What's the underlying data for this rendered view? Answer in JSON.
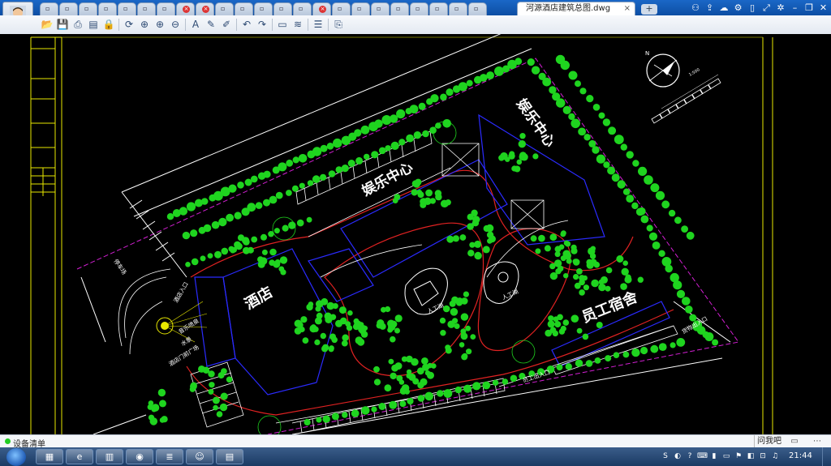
{
  "window": {
    "active_tab_title": "河源酒店建筑总图.dwg",
    "close_glyph": "×",
    "add_tab_glyph": "+",
    "tab_glyphs": [
      "▫",
      "▫",
      "▫",
      "▫",
      "▫",
      "▫",
      "▫",
      "×",
      "×",
      "▫",
      "▫",
      "▫",
      "▫",
      "▫",
      "×",
      "▫",
      "▫",
      "▫",
      "▫",
      "▫",
      "▫",
      "▫",
      "▫"
    ],
    "system_buttons": [
      "user-icon",
      "share-icon",
      "cloud-icon",
      "gear-alt-icon",
      "phone-icon",
      "expand-icon",
      "settings-icon",
      "minimize-icon",
      "maximize-icon",
      "close-icon"
    ],
    "system_glyphs": [
      "⚇",
      "⇪",
      "☁",
      "⚙",
      "▯",
      "⤢",
      "✲",
      "–",
      "❐",
      "✕"
    ]
  },
  "toolbar": {
    "items": [
      {
        "name": "open-icon",
        "glyph": "📂"
      },
      {
        "name": "save-icon",
        "glyph": "💾"
      },
      {
        "name": "print-icon",
        "glyph": "⎙"
      },
      {
        "name": "pdf-icon",
        "glyph": "▤"
      },
      {
        "name": "lock-icon",
        "glyph": "🔒"
      },
      {
        "name": "rotate-icon",
        "glyph": "⟳"
      },
      {
        "name": "zoom-icon",
        "glyph": "⊕"
      },
      {
        "name": "zoom-in-icon",
        "glyph": "⊕"
      },
      {
        "name": "zoom-out-icon",
        "glyph": "⊖"
      },
      {
        "name": "text-icon",
        "glyph": "A"
      },
      {
        "name": "pen-icon",
        "glyph": "✎"
      },
      {
        "name": "marker-icon",
        "glyph": "✐"
      },
      {
        "name": "undo-icon",
        "glyph": "↶"
      },
      {
        "name": "redo-icon",
        "glyph": "↷"
      },
      {
        "name": "measure-icon",
        "glyph": "▭"
      },
      {
        "name": "dimension-icon",
        "glyph": "≋"
      },
      {
        "name": "layers-icon",
        "glyph": "☰"
      },
      {
        "name": "export-icon",
        "glyph": "⎘"
      }
    ]
  },
  "drawing": {
    "labels": {
      "entertainment_center_1": "娱乐中心",
      "entertainment_center_2": "娱乐中心",
      "hotel": "酒店",
      "staff_dorm": "员工宿舍",
      "artificial_lake_1": "人工湖",
      "artificial_lake_2": "人工湖",
      "hotel_entrance": "酒店入口",
      "staff_entrance": "员工出入口",
      "delivery_entrance": "货物出入口",
      "parking_left": "停车场",
      "plaza": "酒店门前广场",
      "fountain": "音乐喷泉",
      "water": "水景",
      "north": "N",
      "scale": "1:500"
    },
    "colors": {
      "canvas": "#000000",
      "tree": "#1fd41f",
      "building": "#2b2bff",
      "road": "#e02222",
      "path": "#ffffff",
      "boundary": "#d21fd2",
      "frame": "#e8e800",
      "label": "#ffffff"
    }
  },
  "status": {
    "text": "设备清单",
    "chat": "问我吧"
  },
  "taskbar": {
    "apps": [
      {
        "name": "explorer-app",
        "glyph": "▦"
      },
      {
        "name": "ie-app",
        "glyph": "e"
      },
      {
        "name": "folder-app",
        "glyph": "▥"
      },
      {
        "name": "media-app",
        "glyph": "◉"
      },
      {
        "name": "stack-app",
        "glyph": "≣"
      },
      {
        "name": "avatar-app",
        "glyph": "☺"
      },
      {
        "name": "cad-app",
        "glyph": "▤"
      }
    ],
    "tray": [
      "S",
      "◐",
      "?",
      "⌨",
      "▮",
      "▭",
      "⚑",
      "◧",
      "⊡",
      "♫"
    ],
    "clock": "21:44"
  }
}
